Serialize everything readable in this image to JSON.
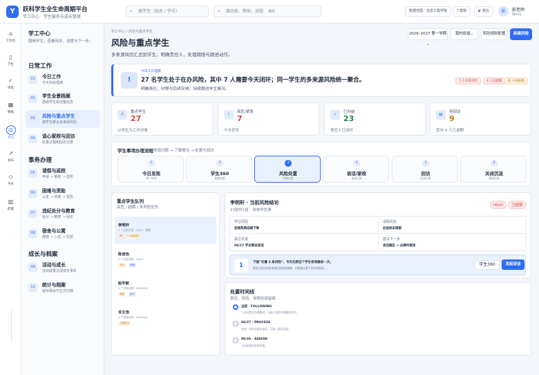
{
  "app": {
    "logo": "Y",
    "title": "跃科学生全生命周期平台",
    "subtitle": "学工中心 · 学生服务与成长管理"
  },
  "search": {
    "student_placeholder": "搜学生（姓名 / 学号）",
    "cmd_placeholder": "搜功能、帮助、流程",
    "cmd_shortcut": "⌘K"
  },
  "topbar": {
    "scope": "数据范围：信息工程学院",
    "help": "帮助",
    "theme": "我在",
    "avatar": "彭",
    "user": "彭老师",
    "role": "辅导员"
  },
  "rail": [
    {
      "icon": "home-icon",
      "glyph": "⌂",
      "label": "工作台"
    },
    {
      "icon": "student-icon",
      "glyph": "▯",
      "label": "学生"
    },
    {
      "icon": "check-icon",
      "glyph": "✓",
      "label": "审批"
    },
    {
      "icon": "grid-icon",
      "glyph": "▦",
      "label": "数据"
    },
    {
      "icon": "target-icon",
      "glyph": "◎",
      "label": "学工"
    },
    {
      "icon": "arrow-icon",
      "glyph": "↗",
      "label": "发布"
    },
    {
      "icon": "diamond-icon",
      "glyph": "◇",
      "label": "平台"
    },
    {
      "icon": "columns-icon",
      "glyph": "▥",
      "label": "配置"
    }
  ],
  "sidebar": {
    "title": "学工中心",
    "desc": "围绕学生，查看待办、进度与下一步。",
    "sections": [
      {
        "title": "日常工作",
        "items": [
          {
            "num": "01",
            "title": "今日工作",
            "desc": "今天先处理谁"
          },
          {
            "num": "02",
            "title": "学生全景档案",
            "desc": "围绕学生看完整信息"
          },
          {
            "num": "03",
            "title": "风险与重点学生",
            "desc": "按学生聚合多来源风险"
          },
          {
            "num": "04",
            "title": "谈心家校与回访",
            "desc": "处置过程和回访记录"
          }
        ]
      },
      {
        "title": "事务办理",
        "items": [
          {
            "num": "05",
            "title": "请假与返校",
            "desc": "申请 → 审批 → 返校"
          },
          {
            "num": "06",
            "title": "困难与资助",
            "desc": "认定 → 资助 → 发放"
          },
          {
            "num": "07",
            "title": "违纪处分与教育",
            "desc": "处分 → 教育 → 回访"
          },
          {
            "num": "08",
            "title": "宿舍与公寓",
            "desc": "报修 → 入住 → 异常"
          }
        ]
      },
      {
        "title": "成长与档案",
        "items": [
          {
            "num": "09",
            "title": "活动与成长",
            "desc": "活动成果沉淀成长事实"
          },
          {
            "num": "12",
            "title": "统计与档案",
            "desc": "留存事由与正式归档"
          }
        ]
      }
    ]
  },
  "page": {
    "breadcrumb": "学工中心 / 风险与重点学生",
    "title": "风险与重点学生",
    "subtitle": "多来源风险汇总到学生，明确责任人，处理期限与跟进动作。",
    "term": "2026–2027 第一学期⌄",
    "class": "我的班级⌄",
    "rules": "风险规则配置",
    "new": "新建风险"
  },
  "alert": {
    "kicker": "今日工作提醒",
    "title": "27 名学生处于在办风险，其中 7 人需要今天闭环；同一学生的多来源风险统一聚合。",
    "desc": "明确责任、时限与后续安排，持续跟进学生情况。",
    "tags": [
      "7 人今日闭环",
      "4 人已超期",
      "处 人待安排"
    ]
  },
  "stats": [
    {
      "icon": "人",
      "label": "重点学生",
      "value": "27",
      "desc": "以学生为工作对象",
      "color": "#d64545"
    },
    {
      "icon": "!",
      "label": "高危/紧急",
      "value": "7",
      "desc": "今天优先",
      "color": "#d64545"
    },
    {
      "icon": "✓",
      "label": "已办结",
      "value": "23",
      "desc": "责任人已闭环",
      "color": "#1f8a4c"
    },
    {
      "icon": "▤",
      "label": "待回访",
      "value": "9",
      "desc": "其中 4 人已逾期",
      "color": "#c57a12"
    }
  ],
  "flow": {
    "title": "学生事项办理流程",
    "hint": "发现问题 → 了解情况 → 处置与回访",
    "steps": [
      {
        "n": "1",
        "title": "今日发现",
        "sub": "第一时间"
      },
      {
        "n": "2",
        "title": "学生360",
        "sub": "查看全貌"
      },
      {
        "n": "3",
        "title": "风险处置",
        "sub": "明确处置"
      },
      {
        "n": "4",
        "title": "谈话/家校",
        "sub": "谈话记录"
      },
      {
        "n": "5",
        "title": "回访",
        "sub": "回访记录"
      },
      {
        "n": "6",
        "title": "关闭沉淀",
        "sub": "案例沉淀"
      }
    ]
  },
  "queue": {
    "title": "重点学生队列",
    "subtitle": "高危 / 超期 / 多风险优先",
    "items": [
      {
        "name": "李明轩",
        "meta": "3 个活跃风险 · HIGH · 超期",
        "badges": [
          "P0",
          "5 天未回访"
        ]
      },
      {
        "name": "陈佳怡",
        "meta": "2 个活跃风险 · HIGH",
        "badges": [
          "学业",
          "家庭"
        ]
      },
      {
        "name": "赵宇航",
        "meta": "2 个活跃风险 · MEDIUM",
        "badges": [
          "宿舍",
          "经济"
        ]
      },
      {
        "name": "许文浩",
        "meta": "1 个活跃风险 · MEDIUM",
        "badges": [
          "心理关注"
        ]
      }
    ]
  },
  "detail": {
    "title": "李明轩 · 当前风险结论",
    "subtitle": "23软件1班 · 张老师负责",
    "badges": [
      "HIGH",
      "已超期"
    ],
    "cells": [
      {
        "label": "学业风险",
        "value": "连续两周成绩下降"
      },
      {
        "label": "请假风险",
        "value": "后返校未销假"
      },
      {
        "label": "最近处置",
        "value": "06/27 学业帮扶谈话"
      },
      {
        "label": "建议下一步",
        "value": "谈话确实 + 必要时家校"
      }
    ],
    "cta_num": "1",
    "cta_title": "下面“先看 3 条风险”，今天先把这个学生有效跟进一次。",
    "cta_desc": "系统已经识别多来源风险信息聚集，并要确认置于风险的情况。",
    "cta_secondary": "学生360",
    "cta_primary": "发起谈话"
  },
  "timeline": {
    "title": "处置时间线",
    "subtitle": "责任、状态、说明全部留痕",
    "items": [
      {
        "title": "当前 · FOLLOWING",
        "desc": "上次处置后仍需跟进，当前已指定时间跟进学生。"
      },
      {
        "title": "06/27 · PROCESS",
        "desc": "完成一次学业帮扶谈话，记录一周后回访。"
      },
      {
        "title": "06/26 · ASSIGN",
        "desc": "分派给责任老师处理。"
      }
    ]
  }
}
